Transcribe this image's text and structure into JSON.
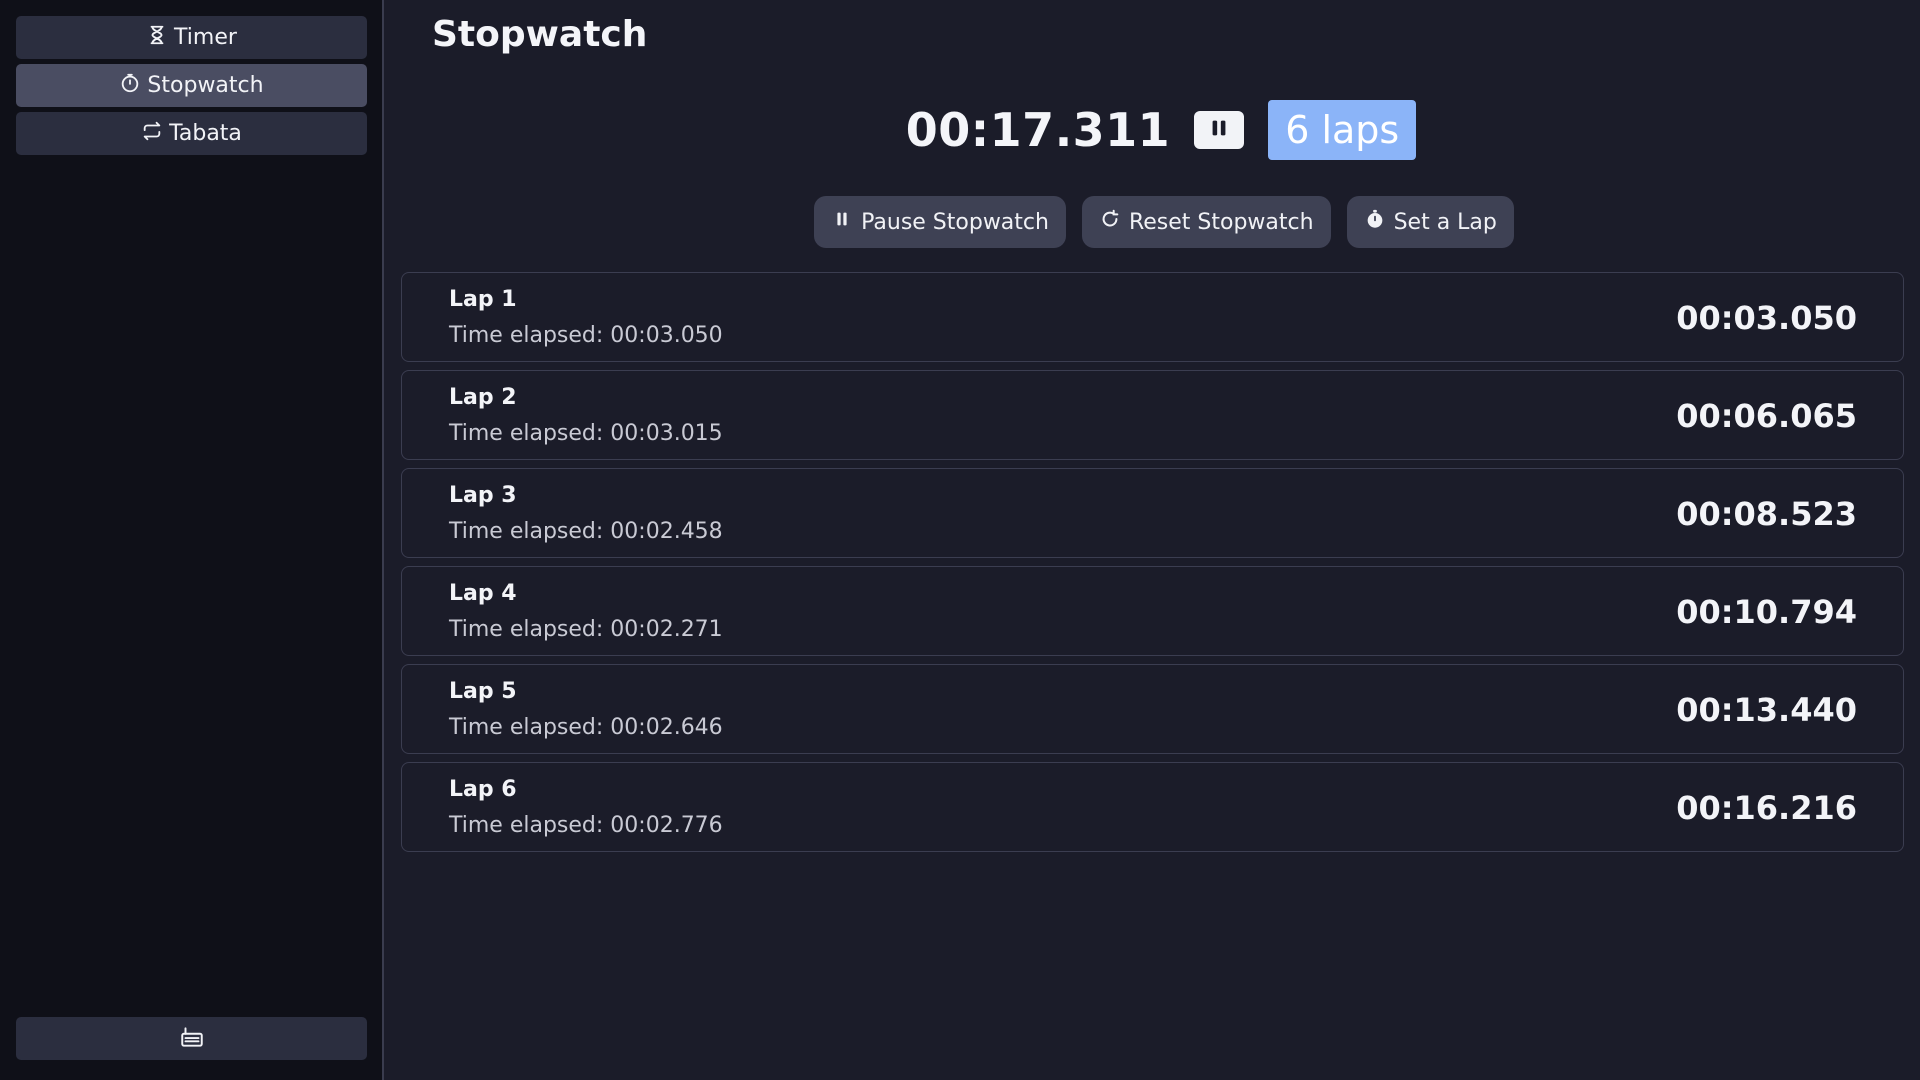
{
  "sidebar": {
    "items": [
      {
        "label": "Timer",
        "icon": "hourglass-icon",
        "active": false
      },
      {
        "label": "Stopwatch",
        "icon": "stopwatch-icon",
        "active": true
      },
      {
        "label": "Tabata",
        "icon": "repeat-icon",
        "active": false
      }
    ],
    "bottom_icon": "keyboard-icon"
  },
  "page": {
    "title": "Stopwatch"
  },
  "clock": {
    "time": "00:17.311",
    "laps_badge": "6 laps",
    "badge_color": "#8bb4f8"
  },
  "actions": {
    "pause_label": "Pause Stopwatch",
    "reset_label": "Reset Stopwatch",
    "lap_label": "Set a Lap"
  },
  "laps": [
    {
      "name": "Lap 1",
      "elapsed": "Time elapsed: 00:03.050",
      "total": "00:03.050"
    },
    {
      "name": "Lap 2",
      "elapsed": "Time elapsed: 00:03.015",
      "total": "00:06.065"
    },
    {
      "name": "Lap 3",
      "elapsed": "Time elapsed: 00:02.458",
      "total": "00:08.523"
    },
    {
      "name": "Lap 4",
      "elapsed": "Time elapsed: 00:02.271",
      "total": "00:10.794"
    },
    {
      "name": "Lap 5",
      "elapsed": "Time elapsed: 00:02.646",
      "total": "00:13.440"
    },
    {
      "name": "Lap 6",
      "elapsed": "Time elapsed: 00:02.776",
      "total": "00:16.216"
    }
  ]
}
